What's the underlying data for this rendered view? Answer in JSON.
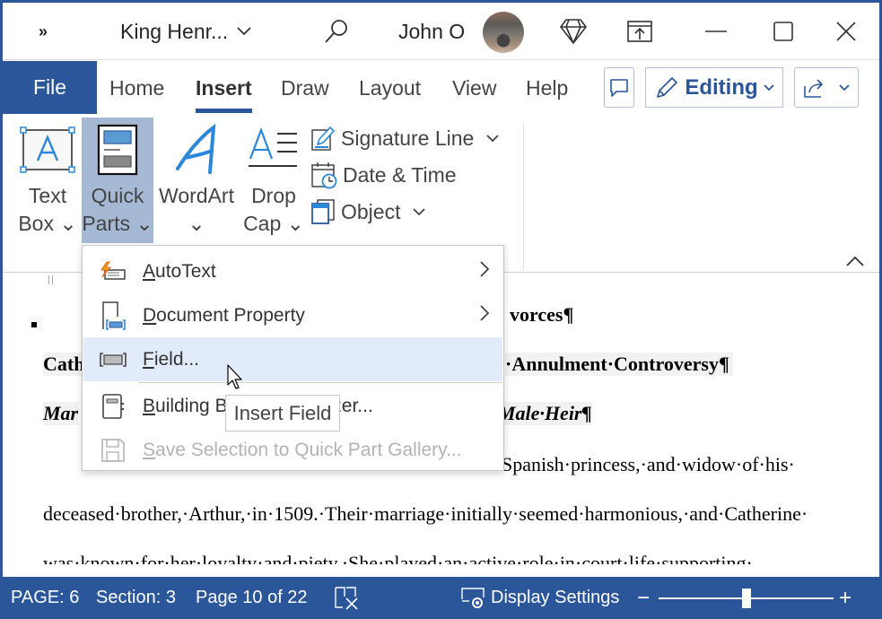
{
  "titlebar": {
    "qat_more": "»",
    "doc_title": "King Henr...",
    "user_name": "John O"
  },
  "tabs": {
    "file": "File",
    "items": [
      {
        "label": "Home"
      },
      {
        "label": "Insert",
        "active": true
      },
      {
        "label": "Draw"
      },
      {
        "label": "Layout"
      },
      {
        "label": "View"
      },
      {
        "label": "Help"
      }
    ],
    "editing_label": "Editing"
  },
  "ribbon": {
    "text_box": {
      "line1": "Text",
      "line2": "Box ⌄"
    },
    "quick_parts": {
      "line1": "Quick",
      "line2": "Parts ⌄"
    },
    "wordart": {
      "line1": "WordArt",
      "line2": "⌄"
    },
    "drop_cap": {
      "line1": "Drop",
      "line2": "Cap ⌄"
    },
    "signature_line": "Signature Line",
    "date_time": "Date & Time",
    "object": "Object"
  },
  "quick_parts_menu": {
    "items": [
      {
        "accel": "A",
        "rest": "utoText",
        "submenu": true,
        "icon": "autotext-icon"
      },
      {
        "accel": "D",
        "rest": "ocument Property",
        "submenu": true,
        "icon": "document-property-icon"
      },
      {
        "accel": "F",
        "rest": "ield...",
        "submenu": false,
        "icon": "field-icon",
        "hovered": true
      },
      {
        "accel": "B",
        "rest": "uilding Blocks Organizer...",
        "submenu": false,
        "icon": "building-blocks-icon"
      },
      {
        "accel": "S",
        "rest": "ave Selection to Quick Part Gallery...",
        "submenu": false,
        "icon": "save-icon",
        "disabled": true
      }
    ],
    "tooltip": "Insert Field"
  },
  "document": {
    "heading1_visible": "vorces¶",
    "heading2_left": "Cath",
    "heading2_right": "·Annulment·Controversy¶",
    "heading3_left": "Mar",
    "heading3_right": "Male·Heir¶",
    "para_line1_right": "Spanish·princess,·and·widow·of·his·",
    "para_line2": "deceased·brother,·Arthur,·in·1509.·Their·marriage·initially·seemed·harmonious,·and·Catherine·",
    "para_line3": "was·known·for·her·loyalty·and·piety.·She·played·an·active·role·in·court·life·supporting·"
  },
  "statusbar": {
    "page": "PAGE: 6",
    "section": "Section: 3",
    "page_of": "Page 10 of 22",
    "display_settings": "Display Settings",
    "zoom_out": "−",
    "zoom_in": "+",
    "zoom_slider_fraction": 0.5
  },
  "colors": {
    "accent": "#2b579a",
    "selected_ribbon": "#a5b9d5",
    "menu_hover": "#e1ebf9"
  }
}
